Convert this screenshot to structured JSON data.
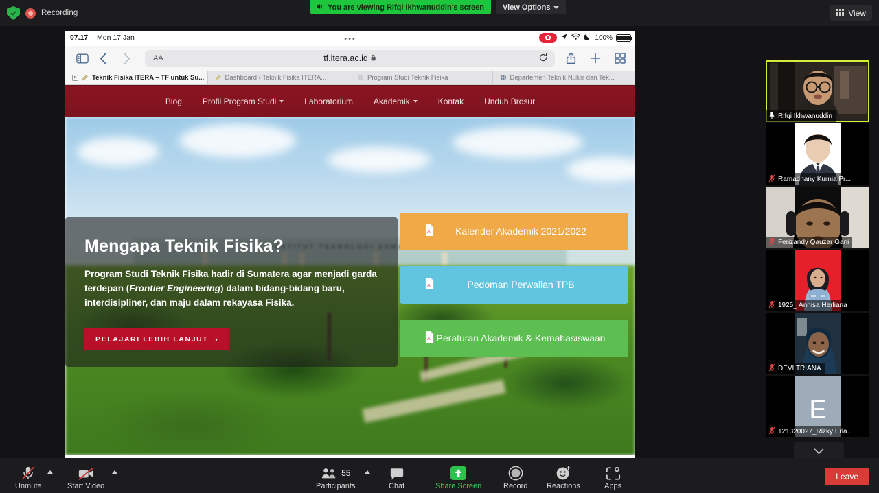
{
  "topbar": {
    "shield_icon": "security-shield-icon",
    "recording_label": "Recording",
    "viewing_banner": "You are viewing Rifqi Ikhwanuddin's screen",
    "speaker_icon": "speaker-icon",
    "view_options_label": "View Options",
    "view_label": "View",
    "view_icon": "grid-icon"
  },
  "shared_screen": {
    "ios_status": {
      "time": "07.17",
      "date": "Mon 17 Jan",
      "dots": "•••",
      "record_indicator": "screen-record-icon",
      "location_icon": "location-arrow-icon",
      "wifi_icon": "wifi-icon",
      "dnd_icon": "moon-icon",
      "battery_percent": "100%"
    },
    "browser": {
      "sidebar_icon": "sidebar-toggle-icon",
      "back_icon": "chevron-left-icon",
      "forward_icon": "chevron-right-icon",
      "aa_label": "AA",
      "url": "tf.itera.ac.id",
      "lock_icon": "lock-icon",
      "reload_icon": "reload-icon",
      "share_icon": "share-icon",
      "newtab_icon": "plus-icon",
      "tabs_overview_icon": "tab-overview-icon",
      "tabs": [
        {
          "title": "Teknik Fisika ITERA – TF untuk Su...",
          "active": true,
          "favicon": "pencil-icon",
          "close": "×"
        },
        {
          "title": "Dashboard ‹ Teknik Fisika ITERA...",
          "active": false,
          "favicon": "pencil-icon",
          "close": ""
        },
        {
          "title": "Program Studi Teknik Fisika",
          "active": false,
          "favicon": "page-icon",
          "close": ""
        },
        {
          "title": "Departemen Teknik Nuklir dan Tek...",
          "active": false,
          "favicon": "globe-icon",
          "close": ""
        }
      ]
    },
    "site": {
      "nav": [
        {
          "label": "Blog",
          "has_dropdown": false
        },
        {
          "label": "Profil Program Studi",
          "has_dropdown": true
        },
        {
          "label": "Laboratorium",
          "has_dropdown": false
        },
        {
          "label": "Akademik",
          "has_dropdown": true
        },
        {
          "label": "Kontak",
          "has_dropdown": false
        },
        {
          "label": "Unduh Brosur",
          "has_dropdown": false
        }
      ],
      "nav_bg": "#8b1420",
      "hero": {
        "gate_text": "INSTITUT TEKNOLOGI SUMATERA",
        "title": "Mengapa Teknik Fisika?",
        "body_part1": "Program Studi Teknik Fisika hadir di Sumatera agar menjadi garda terdepan (",
        "body_italic": "Frontier Engineering",
        "body_part2": ") dalam bidang-bidang baru, interdisipliner, dan maju dalam rekayasa Fisika.",
        "cta_label": "PELAJARI LEBIH LANJUT",
        "cta_arrow": "›"
      },
      "doc_buttons": [
        {
          "label": "Kalender Akademik 2021/2022",
          "color": "#efa947",
          "icon": "pdf-file-icon"
        },
        {
          "label": "Pedoman Perwalian TPB",
          "color": "#62c5e0",
          "icon": "pdf-file-icon"
        },
        {
          "label": "Peraturan Akademik & Kemahasiswaan",
          "color": "#5dbe51",
          "icon": "pdf-file-icon"
        }
      ]
    }
  },
  "participants": {
    "tiles": [
      {
        "name": "Rifqi Ikhwanuddin",
        "muted": false,
        "pinned": true,
        "speaking": true,
        "avatar_type": "video",
        "avatar_letter": ""
      },
      {
        "name": "Ramadhany Kurnia Pr...",
        "muted": true,
        "pinned": false,
        "speaking": false,
        "avatar_type": "photo",
        "avatar_letter": ""
      },
      {
        "name": "Ferizandy Qauzar Gani",
        "muted": true,
        "pinned": false,
        "speaking": false,
        "avatar_type": "video",
        "avatar_letter": ""
      },
      {
        "name": "1925_ Annisa Herliana",
        "muted": true,
        "pinned": false,
        "speaking": false,
        "avatar_type": "photo",
        "avatar_letter": ""
      },
      {
        "name": "DEVI TRIANA",
        "muted": true,
        "pinned": false,
        "speaking": false,
        "avatar_type": "video",
        "avatar_letter": ""
      },
      {
        "name": "121320027_Rizky Erla...",
        "muted": true,
        "pinned": false,
        "speaking": false,
        "avatar_type": "letter",
        "avatar_letter": "E"
      }
    ],
    "scroll_down_icon": "chevron-down-icon"
  },
  "bottom_toolbar": {
    "unmute_label": "Unmute",
    "unmute_icon": "mic-off-icon",
    "start_video_label": "Start Video",
    "start_video_icon": "video-off-icon",
    "participants_label": "Participants",
    "participants_count": "55",
    "participants_icon": "people-icon",
    "chat_label": "Chat",
    "chat_icon": "chat-bubble-icon",
    "share_screen_label": "Share Screen",
    "share_screen_icon": "share-screen-up-arrow-icon",
    "record_label": "Record",
    "record_icon": "record-circle-icon",
    "reactions_label": "Reactions",
    "reactions_icon": "smiley-icon",
    "apps_label": "Apps",
    "apps_icon": "apps-bracket-icon",
    "leave_label": "Leave",
    "share_accent": "#3ecb5c",
    "leave_accent": "#d93b36"
  }
}
